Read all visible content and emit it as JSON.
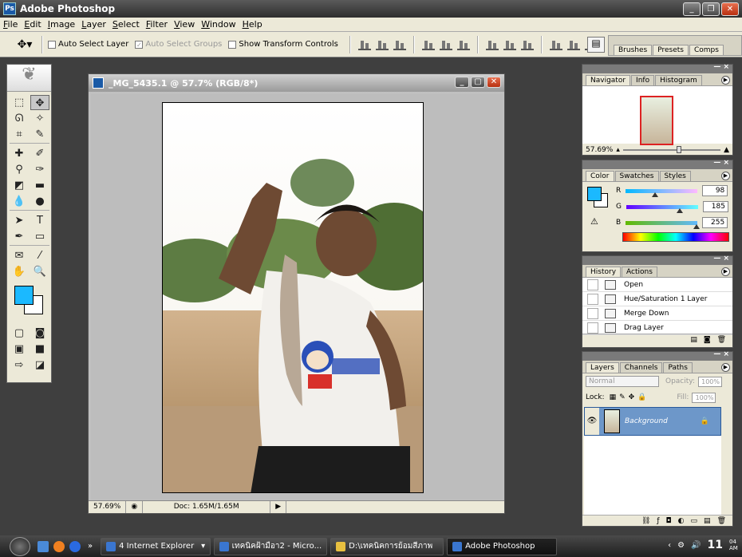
{
  "app": {
    "title": "Adobe Photoshop"
  },
  "menu": [
    "File",
    "Edit",
    "Image",
    "Layer",
    "Select",
    "Filter",
    "View",
    "Window",
    "Help"
  ],
  "options": {
    "auto_select_layer": "Auto Select Layer",
    "auto_select_groups": "Auto Select Groups",
    "show_transform_controls": "Show Transform Controls",
    "well_tabs": [
      "Brushes",
      "Presets",
      "Comps"
    ]
  },
  "document": {
    "title": "_MG_5435.1 @ 57.7% (RGB/8*)",
    "zoom": "57.69%",
    "doc_size": "Doc: 1.65M/1.65M"
  },
  "navigator": {
    "tabs": [
      "Navigator",
      "Info",
      "Histogram"
    ],
    "zoom": "57.69%"
  },
  "color": {
    "tabs": [
      "Color",
      "Swatches",
      "Styles"
    ],
    "r_label": "R",
    "g_label": "G",
    "b_label": "B",
    "r": "98",
    "g": "185",
    "b": "255",
    "foreground": "#1bb9ff"
  },
  "history": {
    "tabs": [
      "History",
      "Actions"
    ],
    "items": [
      "Open",
      "Hue/Saturation 1 Layer",
      "Merge Down",
      "Drag Layer"
    ]
  },
  "layers": {
    "tabs": [
      "Layers",
      "Channels",
      "Paths"
    ],
    "blend_mode": "Normal",
    "opacity_label": "Opacity:",
    "opacity": "100%",
    "lock_label": "Lock:",
    "fill_label": "Fill:",
    "fill": "100%",
    "layer_name": "Background"
  },
  "taskbar": {
    "items": [
      "4 Internet Explorer",
      "เทคนิคฝ้ามือา2 - Micro...",
      "D:\\เทคนิคการย้อมสีภาพ",
      "Adobe Photoshop"
    ],
    "clock": "11",
    "clock_small": "04 AM"
  }
}
